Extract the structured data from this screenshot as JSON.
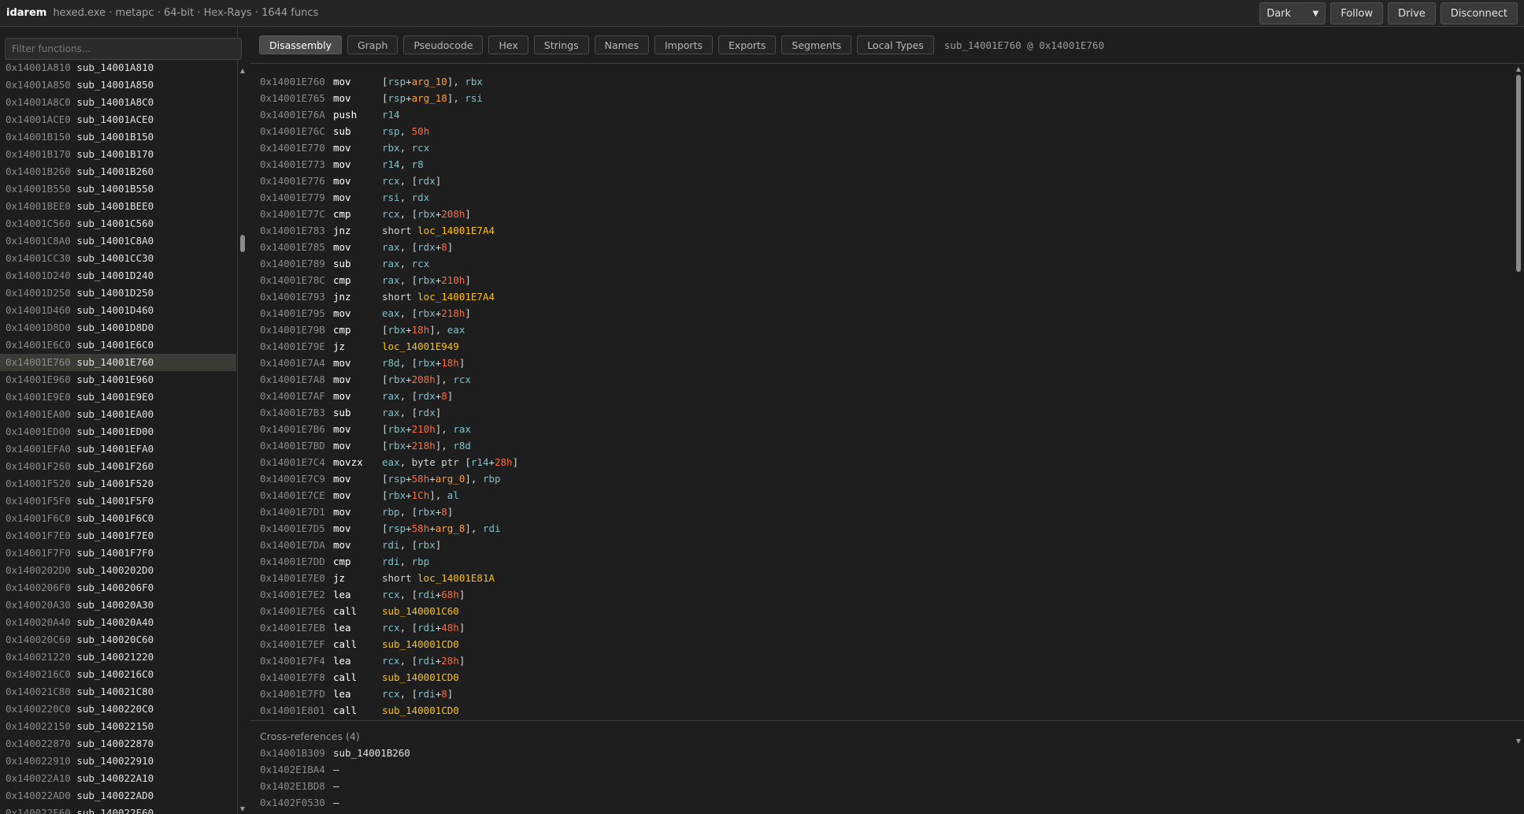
{
  "app": {
    "name": "idarem",
    "info": "hexed.exe · metapc · 64-bit · Hex-Rays · 1644 funcs"
  },
  "top_actions": {
    "theme_value": "Dark",
    "theme_options": [
      "Dark"
    ],
    "follow": "Follow",
    "drive": "Drive",
    "disconnect": "Disconnect"
  },
  "sidebar": {
    "filter_placeholder": "Filter functions...",
    "functions": [
      {
        "addr": "0x14001A810",
        "name": "sub_14001A810"
      },
      {
        "addr": "0x14001A850",
        "name": "sub_14001A850"
      },
      {
        "addr": "0x14001A8C0",
        "name": "sub_14001A8C0"
      },
      {
        "addr": "0x14001ACE0",
        "name": "sub_14001ACE0"
      },
      {
        "addr": "0x14001B150",
        "name": "sub_14001B150"
      },
      {
        "addr": "0x14001B170",
        "name": "sub_14001B170"
      },
      {
        "addr": "0x14001B260",
        "name": "sub_14001B260"
      },
      {
        "addr": "0x14001B550",
        "name": "sub_14001B550"
      },
      {
        "addr": "0x14001BEE0",
        "name": "sub_14001BEE0"
      },
      {
        "addr": "0x14001C560",
        "name": "sub_14001C560"
      },
      {
        "addr": "0x14001C8A0",
        "name": "sub_14001C8A0"
      },
      {
        "addr": "0x14001CC30",
        "name": "sub_14001CC30"
      },
      {
        "addr": "0x14001D240",
        "name": "sub_14001D240"
      },
      {
        "addr": "0x14001D250",
        "name": "sub_14001D250"
      },
      {
        "addr": "0x14001D460",
        "name": "sub_14001D460"
      },
      {
        "addr": "0x14001D8D0",
        "name": "sub_14001D8D0"
      },
      {
        "addr": "0x14001E6C0",
        "name": "sub_14001E6C0"
      },
      {
        "addr": "0x14001E760",
        "name": "sub_14001E760",
        "selected": true
      },
      {
        "addr": "0x14001E960",
        "name": "sub_14001E960"
      },
      {
        "addr": "0x14001E9E0",
        "name": "sub_14001E9E0"
      },
      {
        "addr": "0x14001EA00",
        "name": "sub_14001EA00"
      },
      {
        "addr": "0x14001ED00",
        "name": "sub_14001ED00"
      },
      {
        "addr": "0x14001EFA0",
        "name": "sub_14001EFA0"
      },
      {
        "addr": "0x14001F260",
        "name": "sub_14001F260"
      },
      {
        "addr": "0x14001F520",
        "name": "sub_14001F520"
      },
      {
        "addr": "0x14001F5F0",
        "name": "sub_14001F5F0"
      },
      {
        "addr": "0x14001F6C0",
        "name": "sub_14001F6C0"
      },
      {
        "addr": "0x14001F7E0",
        "name": "sub_14001F7E0"
      },
      {
        "addr": "0x14001F7F0",
        "name": "sub_14001F7F0"
      },
      {
        "addr": "0x1400202D0",
        "name": "sub_1400202D0"
      },
      {
        "addr": "0x1400206F0",
        "name": "sub_1400206F0"
      },
      {
        "addr": "0x140020A30",
        "name": "sub_140020A30"
      },
      {
        "addr": "0x140020A40",
        "name": "sub_140020A40"
      },
      {
        "addr": "0x140020C60",
        "name": "sub_140020C60"
      },
      {
        "addr": "0x140021220",
        "name": "sub_140021220"
      },
      {
        "addr": "0x1400216C0",
        "name": "sub_1400216C0"
      },
      {
        "addr": "0x140021C80",
        "name": "sub_140021C80"
      },
      {
        "addr": "0x1400220C0",
        "name": "sub_1400220C0"
      },
      {
        "addr": "0x140022150",
        "name": "sub_140022150"
      },
      {
        "addr": "0x140022870",
        "name": "sub_140022870"
      },
      {
        "addr": "0x140022910",
        "name": "sub_140022910"
      },
      {
        "addr": "0x140022A10",
        "name": "sub_140022A10"
      },
      {
        "addr": "0x140022AD0",
        "name": "sub_140022AD0"
      },
      {
        "addr": "0x140022E60",
        "name": "sub_140022E60"
      }
    ]
  },
  "tabs": [
    {
      "label": "Disassembly",
      "active": true
    },
    {
      "label": "Graph"
    },
    {
      "label": "Pseudocode"
    },
    {
      "label": "Hex"
    },
    {
      "label": "Strings"
    },
    {
      "label": "Names"
    },
    {
      "label": "Imports"
    },
    {
      "label": "Exports"
    },
    {
      "label": "Segments"
    },
    {
      "label": "Local Types"
    }
  ],
  "location": "sub_14001E760 @ 0x14001E760",
  "disassembly": [
    {
      "addr": "0x14001E760",
      "mnem": "mov",
      "ops": [
        [
          "m",
          "["
        ],
        [
          "r",
          "rsp"
        ],
        [
          "m",
          "+"
        ],
        [
          "v",
          "arg_10"
        ],
        [
          "m",
          "], "
        ],
        [
          "r",
          "rbx"
        ]
      ]
    },
    {
      "addr": "0x14001E765",
      "mnem": "mov",
      "ops": [
        [
          "m",
          "["
        ],
        [
          "r",
          "rsp"
        ],
        [
          "m",
          "+"
        ],
        [
          "v",
          "arg_18"
        ],
        [
          "m",
          "], "
        ],
        [
          "r",
          "rsi"
        ]
      ]
    },
    {
      "addr": "0x14001E76A",
      "mnem": "push",
      "ops": [
        [
          "r",
          "r14"
        ]
      ]
    },
    {
      "addr": "0x14001E76C",
      "mnem": "sub",
      "ops": [
        [
          "r",
          "rsp"
        ],
        [
          "m",
          ", "
        ],
        [
          "n",
          "50h"
        ]
      ]
    },
    {
      "addr": "0x14001E770",
      "mnem": "mov",
      "ops": [
        [
          "r",
          "rbx"
        ],
        [
          "m",
          ", "
        ],
        [
          "r",
          "rcx"
        ]
      ]
    },
    {
      "addr": "0x14001E773",
      "mnem": "mov",
      "ops": [
        [
          "r",
          "r14"
        ],
        [
          "m",
          ", "
        ],
        [
          "r",
          "r8"
        ]
      ]
    },
    {
      "addr": "0x14001E776",
      "mnem": "mov",
      "ops": [
        [
          "r",
          "rcx"
        ],
        [
          "m",
          ", ["
        ],
        [
          "r",
          "rdx"
        ],
        [
          "m",
          "]"
        ]
      ]
    },
    {
      "addr": "0x14001E779",
      "mnem": "mov",
      "ops": [
        [
          "r",
          "rsi"
        ],
        [
          "m",
          ", "
        ],
        [
          "r",
          "rdx"
        ]
      ]
    },
    {
      "addr": "0x14001E77C",
      "mnem": "cmp",
      "ops": [
        [
          "r",
          "rcx"
        ],
        [
          "m",
          ", ["
        ],
        [
          "r",
          "rbx"
        ],
        [
          "m",
          "+"
        ],
        [
          "n",
          "208h"
        ],
        [
          "m",
          "]"
        ]
      ]
    },
    {
      "addr": "0x14001E783",
      "mnem": "jnz",
      "ops": [
        [
          "t",
          "short "
        ],
        [
          "l",
          "loc_14001E7A4"
        ]
      ]
    },
    {
      "addr": "0x14001E785",
      "mnem": "mov",
      "ops": [
        [
          "r",
          "rax"
        ],
        [
          "m",
          ", ["
        ],
        [
          "r",
          "rdx"
        ],
        [
          "m",
          "+"
        ],
        [
          "n",
          "8"
        ],
        [
          "m",
          "]"
        ]
      ]
    },
    {
      "addr": "0x14001E789",
      "mnem": "sub",
      "ops": [
        [
          "r",
          "rax"
        ],
        [
          "m",
          ", "
        ],
        [
          "r",
          "rcx"
        ]
      ]
    },
    {
      "addr": "0x14001E78C",
      "mnem": "cmp",
      "ops": [
        [
          "r",
          "rax"
        ],
        [
          "m",
          ", ["
        ],
        [
          "r",
          "rbx"
        ],
        [
          "m",
          "+"
        ],
        [
          "n",
          "210h"
        ],
        [
          "m",
          "]"
        ]
      ]
    },
    {
      "addr": "0x14001E793",
      "mnem": "jnz",
      "ops": [
        [
          "t",
          "short "
        ],
        [
          "l",
          "loc_14001E7A4"
        ]
      ]
    },
    {
      "addr": "0x14001E795",
      "mnem": "mov",
      "ops": [
        [
          "r",
          "eax"
        ],
        [
          "m",
          ", ["
        ],
        [
          "r",
          "rbx"
        ],
        [
          "m",
          "+"
        ],
        [
          "n",
          "218h"
        ],
        [
          "m",
          "]"
        ]
      ]
    },
    {
      "addr": "0x14001E79B",
      "mnem": "cmp",
      "ops": [
        [
          "m",
          "["
        ],
        [
          "r",
          "rbx"
        ],
        [
          "m",
          "+"
        ],
        [
          "n",
          "18h"
        ],
        [
          "m",
          "], "
        ],
        [
          "r",
          "eax"
        ]
      ]
    },
    {
      "addr": "0x14001E79E",
      "mnem": "jz",
      "ops": [
        [
          "l",
          "loc_14001E949"
        ]
      ]
    },
    {
      "addr": "0x14001E7A4",
      "mnem": "mov",
      "ops": [
        [
          "r",
          "r8d"
        ],
        [
          "m",
          ", ["
        ],
        [
          "r",
          "rbx"
        ],
        [
          "m",
          "+"
        ],
        [
          "n",
          "18h"
        ],
        [
          "m",
          "]"
        ]
      ]
    },
    {
      "addr": "0x14001E7A8",
      "mnem": "mov",
      "ops": [
        [
          "m",
          "["
        ],
        [
          "r",
          "rbx"
        ],
        [
          "m",
          "+"
        ],
        [
          "n",
          "208h"
        ],
        [
          "m",
          "], "
        ],
        [
          "r",
          "rcx"
        ]
      ]
    },
    {
      "addr": "0x14001E7AF",
      "mnem": "mov",
      "ops": [
        [
          "r",
          "rax"
        ],
        [
          "m",
          ", ["
        ],
        [
          "r",
          "rdx"
        ],
        [
          "m",
          "+"
        ],
        [
          "n",
          "8"
        ],
        [
          "m",
          "]"
        ]
      ]
    },
    {
      "addr": "0x14001E7B3",
      "mnem": "sub",
      "ops": [
        [
          "r",
          "rax"
        ],
        [
          "m",
          ", ["
        ],
        [
          "r",
          "rdx"
        ],
        [
          "m",
          "]"
        ]
      ]
    },
    {
      "addr": "0x14001E7B6",
      "mnem": "mov",
      "ops": [
        [
          "m",
          "["
        ],
        [
          "r",
          "rbx"
        ],
        [
          "m",
          "+"
        ],
        [
          "n",
          "210h"
        ],
        [
          "m",
          "], "
        ],
        [
          "r",
          "rax"
        ]
      ]
    },
    {
      "addr": "0x14001E7BD",
      "mnem": "mov",
      "ops": [
        [
          "m",
          "["
        ],
        [
          "r",
          "rbx"
        ],
        [
          "m",
          "+"
        ],
        [
          "n",
          "218h"
        ],
        [
          "m",
          "], "
        ],
        [
          "r",
          "r8d"
        ]
      ]
    },
    {
      "addr": "0x14001E7C4",
      "mnem": "movzx",
      "ops": [
        [
          "r",
          "eax"
        ],
        [
          "m",
          ", byte ptr ["
        ],
        [
          "r",
          "r14"
        ],
        [
          "m",
          "+"
        ],
        [
          "n",
          "28h"
        ],
        [
          "m",
          "]"
        ]
      ]
    },
    {
      "addr": "0x14001E7C9",
      "mnem": "mov",
      "ops": [
        [
          "m",
          "["
        ],
        [
          "r",
          "rsp"
        ],
        [
          "m",
          "+"
        ],
        [
          "n",
          "58h"
        ],
        [
          "m",
          "+"
        ],
        [
          "v",
          "arg_0"
        ],
        [
          "m",
          "], "
        ],
        [
          "r",
          "rbp"
        ]
      ]
    },
    {
      "addr": "0x14001E7CE",
      "mnem": "mov",
      "ops": [
        [
          "m",
          "["
        ],
        [
          "r",
          "rbx"
        ],
        [
          "m",
          "+"
        ],
        [
          "n",
          "1Ch"
        ],
        [
          "m",
          "], "
        ],
        [
          "r",
          "al"
        ]
      ]
    },
    {
      "addr": "0x14001E7D1",
      "mnem": "mov",
      "ops": [
        [
          "r",
          "rbp"
        ],
        [
          "m",
          ", ["
        ],
        [
          "r",
          "rbx"
        ],
        [
          "m",
          "+"
        ],
        [
          "n",
          "8"
        ],
        [
          "m",
          "]"
        ]
      ]
    },
    {
      "addr": "0x14001E7D5",
      "mnem": "mov",
      "ops": [
        [
          "m",
          "["
        ],
        [
          "r",
          "rsp"
        ],
        [
          "m",
          "+"
        ],
        [
          "n",
          "58h"
        ],
        [
          "m",
          "+"
        ],
        [
          "v",
          "arg_8"
        ],
        [
          "m",
          "], "
        ],
        [
          "r",
          "rdi"
        ]
      ]
    },
    {
      "addr": "0x14001E7DA",
      "mnem": "mov",
      "ops": [
        [
          "r",
          "rdi"
        ],
        [
          "m",
          ", ["
        ],
        [
          "r",
          "rbx"
        ],
        [
          "m",
          "]"
        ]
      ]
    },
    {
      "addr": "0x14001E7DD",
      "mnem": "cmp",
      "ops": [
        [
          "r",
          "rdi"
        ],
        [
          "m",
          ", "
        ],
        [
          "r",
          "rbp"
        ]
      ]
    },
    {
      "addr": "0x14001E7E0",
      "mnem": "jz",
      "ops": [
        [
          "t",
          "short "
        ],
        [
          "l",
          "loc_14001E81A"
        ]
      ]
    },
    {
      "addr": "0x14001E7E2",
      "mnem": "lea",
      "ops": [
        [
          "r",
          "rcx"
        ],
        [
          "m",
          ", ["
        ],
        [
          "r",
          "rdi"
        ],
        [
          "m",
          "+"
        ],
        [
          "n",
          "68h"
        ],
        [
          "m",
          "]"
        ]
      ]
    },
    {
      "addr": "0x14001E7E6",
      "mnem": "call",
      "ops": [
        [
          "l",
          "sub_140001C60"
        ]
      ]
    },
    {
      "addr": "0x14001E7EB",
      "mnem": "lea",
      "ops": [
        [
          "r",
          "rcx"
        ],
        [
          "m",
          ", ["
        ],
        [
          "r",
          "rdi"
        ],
        [
          "m",
          "+"
        ],
        [
          "n",
          "48h"
        ],
        [
          "m",
          "]"
        ]
      ]
    },
    {
      "addr": "0x14001E7EF",
      "mnem": "call",
      "ops": [
        [
          "l",
          "sub_140001CD0"
        ]
      ]
    },
    {
      "addr": "0x14001E7F4",
      "mnem": "lea",
      "ops": [
        [
          "r",
          "rcx"
        ],
        [
          "m",
          ", ["
        ],
        [
          "r",
          "rdi"
        ],
        [
          "m",
          "+"
        ],
        [
          "n",
          "28h"
        ],
        [
          "m",
          "]"
        ]
      ]
    },
    {
      "addr": "0x14001E7F8",
      "mnem": "call",
      "ops": [
        [
          "l",
          "sub_140001CD0"
        ]
      ]
    },
    {
      "addr": "0x14001E7FD",
      "mnem": "lea",
      "ops": [
        [
          "r",
          "rcx"
        ],
        [
          "m",
          ", ["
        ],
        [
          "r",
          "rdi"
        ],
        [
          "m",
          "+"
        ],
        [
          "n",
          "8"
        ],
        [
          "m",
          "]"
        ]
      ]
    },
    {
      "addr": "0x14001E801",
      "mnem": "call",
      "ops": [
        [
          "l",
          "sub_140001CD0"
        ]
      ]
    }
  ],
  "xrefs": {
    "title": "Cross-references (4)",
    "items": [
      {
        "addr": "0x14001B309",
        "name": "sub_14001B260"
      },
      {
        "addr": "0x1402E1BA4",
        "name": "—"
      },
      {
        "addr": "0x1402E1BD8",
        "name": "—"
      },
      {
        "addr": "0x1402F0530",
        "name": "—"
      }
    ]
  },
  "colors": {
    "background": "#1e1e1e",
    "register": "#7ec0c8",
    "number": "#ff6a3d",
    "variable": "#ff9f43",
    "location": "#ffc107",
    "selected_row": "#3c3a34"
  },
  "icons": {
    "theme_dropdown": "chevron-down-icon",
    "scroll_up": "scroll-up-arrow-icon",
    "scroll_down": "scroll-down-arrow-icon"
  }
}
